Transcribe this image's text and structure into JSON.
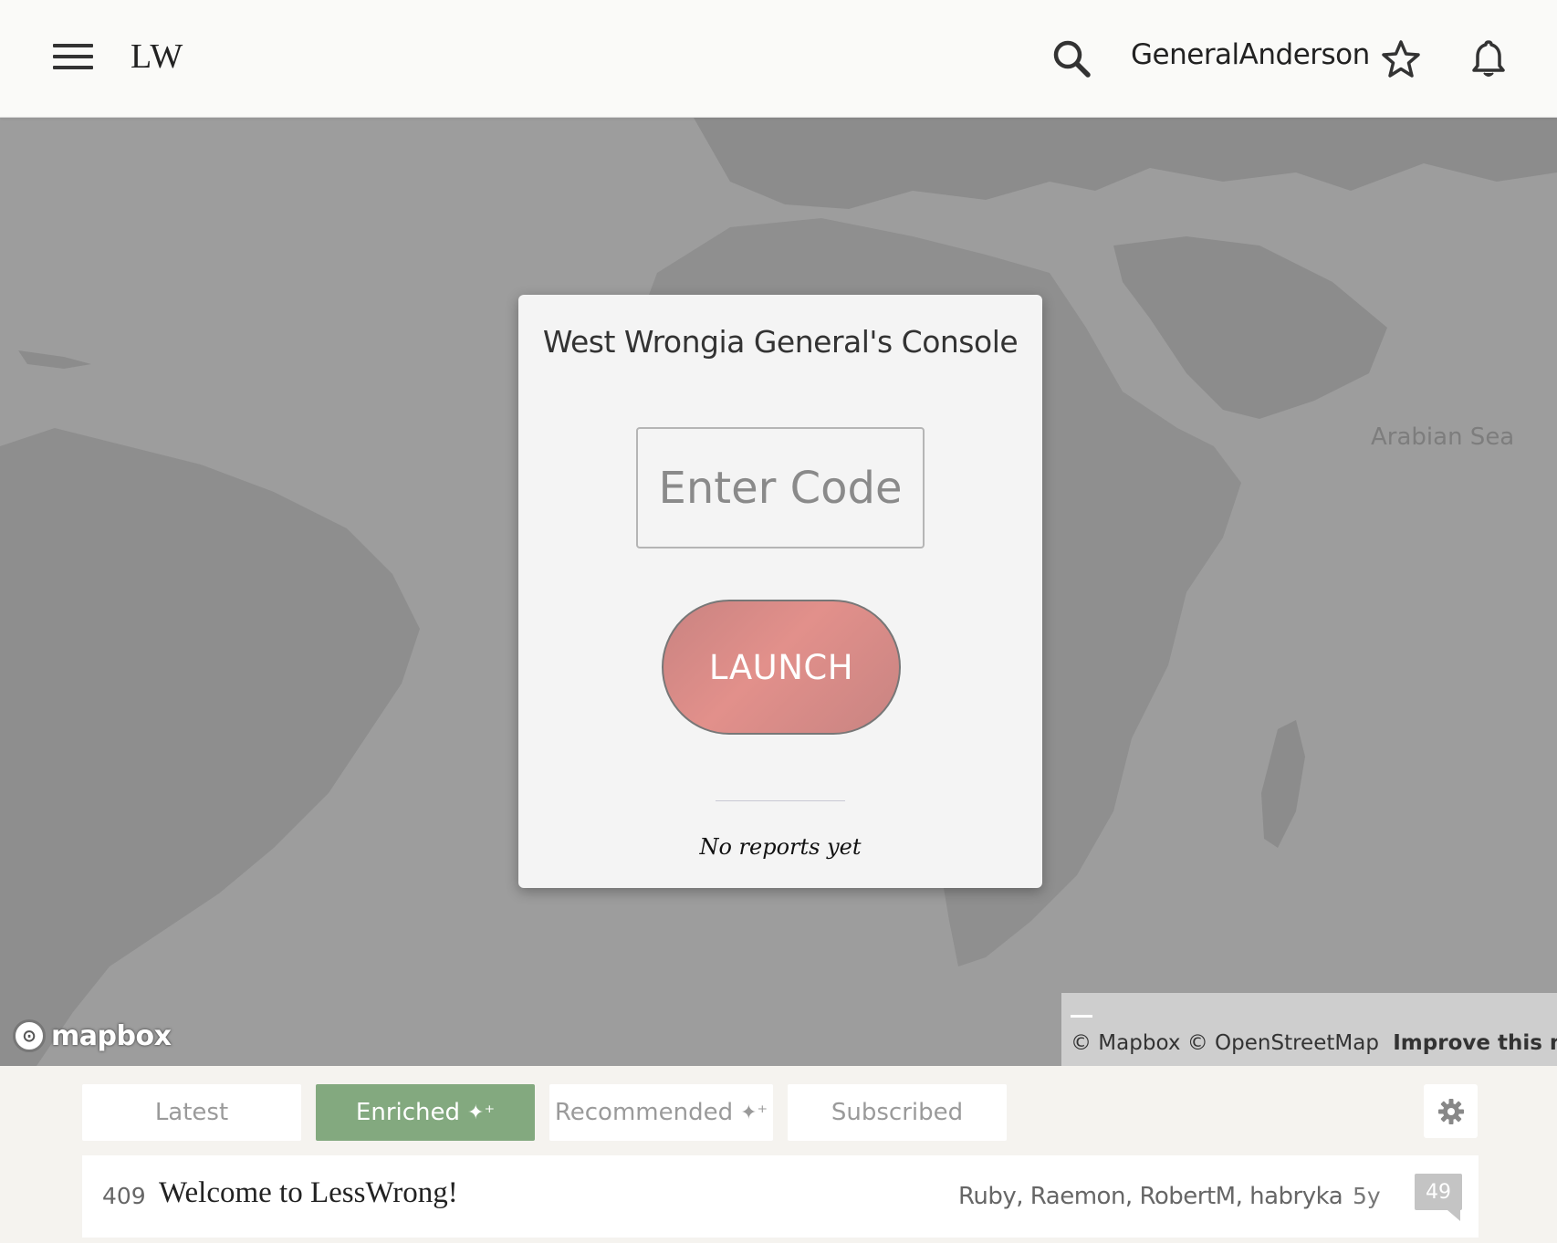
{
  "header": {
    "logo": "LW",
    "username": "GeneralAnderson"
  },
  "map": {
    "sea_label": "Arabian Sea",
    "mapbox_logo_text": "mapbox",
    "attribution": {
      "mapbox": "© Mapbox",
      "osm": "© OpenStreetMap",
      "improve": "Improve this map"
    }
  },
  "console": {
    "title": "West Wrongia General's Console",
    "code_input": {
      "value": "",
      "placeholder": "Enter Code"
    },
    "launch_label": "LAUNCH",
    "reports_text": "No reports yet"
  },
  "tabs": [
    {
      "label": "Latest",
      "active": false
    },
    {
      "label": "Enriched",
      "active": true,
      "sparkle": "✦⁺"
    },
    {
      "label": "Recommended",
      "active": false,
      "sparkle": "✦⁺"
    },
    {
      "label": "Subscribed",
      "active": false
    }
  ],
  "post": {
    "karma": "409",
    "title": "Welcome to LessWrong!",
    "authors": "Ruby, Raemon, RobertM, habryka",
    "age": "5y",
    "comments": "49"
  },
  "colors": {
    "launch": "#e2908b",
    "active_tab": "#83a97f",
    "map_sea": "#9d9d9d",
    "map_land": "#8e8e8e"
  },
  "icons": {
    "menu": "hamburger-menu-icon",
    "search": "search-icon",
    "star": "star-icon",
    "bell": "bell-icon",
    "settings": "gear-icon",
    "sparkle": "sparkle-icon"
  }
}
